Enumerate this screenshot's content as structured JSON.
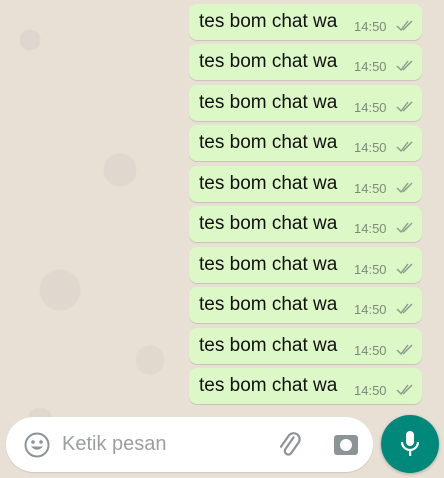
{
  "messages": [
    {
      "text": "tes bom chat wa",
      "time": "14:50",
      "status": "read"
    },
    {
      "text": "tes bom chat wa",
      "time": "14:50",
      "status": "read"
    },
    {
      "text": "tes bom chat wa",
      "time": "14:50",
      "status": "read"
    },
    {
      "text": "tes bom chat wa",
      "time": "14:50",
      "status": "read"
    },
    {
      "text": "tes bom chat wa",
      "time": "14:50",
      "status": "read"
    },
    {
      "text": "tes bom chat wa",
      "time": "14:50",
      "status": "read"
    },
    {
      "text": "tes bom chat wa",
      "time": "14:50",
      "status": "read"
    },
    {
      "text": "tes bom chat wa",
      "time": "14:50",
      "status": "read"
    },
    {
      "text": "tes bom chat wa",
      "time": "14:50",
      "status": "read"
    },
    {
      "text": "tes bom chat wa",
      "time": "14:50",
      "status": "read"
    }
  ],
  "composer": {
    "placeholder": "Ketik pesan",
    "emoji_icon": "emoji-icon",
    "attach_icon": "paperclip-icon",
    "camera_icon": "camera-icon",
    "mic_icon": "microphone-icon"
  },
  "colors": {
    "bubble_outgoing": "#dcf8c6",
    "wallpaper": "#e8e0d5",
    "accent": "#00897b",
    "time_text": "#7d8a7a"
  }
}
